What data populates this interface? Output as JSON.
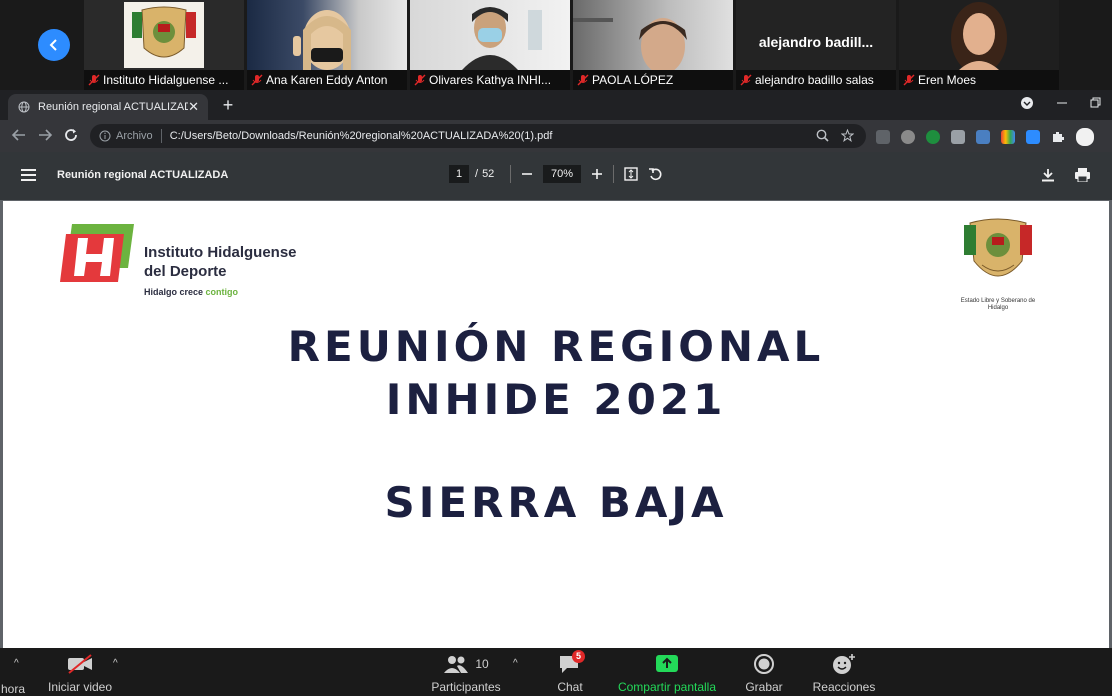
{
  "participants": [
    {
      "name": "Instituto Hidalguense ...",
      "type": "logo"
    },
    {
      "name": "Ana Karen Eddy Anton",
      "type": "video"
    },
    {
      "name": "Olivares Kathya INHI...",
      "type": "video"
    },
    {
      "name": "PAOLA LÓPEZ",
      "type": "video"
    },
    {
      "name": "alejandro badillo salas",
      "display_name": "alejandro  badill...",
      "type": "name"
    },
    {
      "name": "Eren Moes",
      "type": "video"
    }
  ],
  "browser": {
    "tab_title": "Reunión regional ACTUALIZADA",
    "protocol_label": "Archivo",
    "url": "C:/Users/Beto/Downloads/Reunión%20regional%20ACTUALIZADA%20(1).pdf"
  },
  "pdf": {
    "title": "Reunión regional ACTUALIZADA",
    "current_page": "1",
    "page_sep": "/",
    "total_pages": "52",
    "zoom": "70%"
  },
  "slide": {
    "org_line1": "Instituto Hidalguense",
    "org_line2": "del Deporte",
    "tagline_a": "Hidalgo crece",
    "tagline_b": "contigo",
    "seal_caption": "Estado Libre y Soberano de Hidalgo",
    "headline1": "REUNIÓN REGIONAL",
    "headline2": "INHIDE 2021",
    "headline3": "SIERRA BAJA"
  },
  "controls": {
    "audio_label": "hora",
    "video_label": "Iniciar video",
    "participants_label": "Participantes",
    "participants_count": "10",
    "chat_label": "Chat",
    "chat_badge": "5",
    "share_label": "Compartir pantalla",
    "record_label": "Grabar",
    "reactions_label": "Reacciones"
  },
  "colors": {
    "accent_blue": "#2d8cff",
    "share_green": "#23d959",
    "mute_red": "#e02828",
    "headline": "#1c2040"
  }
}
